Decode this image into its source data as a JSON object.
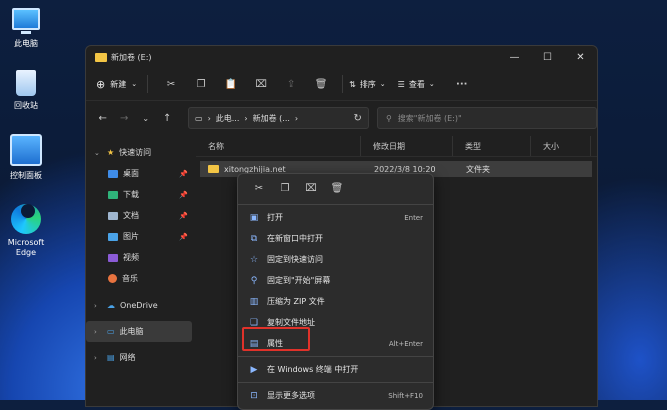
{
  "desktop": {
    "icons": [
      {
        "label": "此电脑",
        "icon": "computer-icon"
      },
      {
        "label": "回收站",
        "icon": "recycle-bin-icon"
      },
      {
        "label": "控制面板",
        "icon": "control-panel-icon"
      },
      {
        "label": "Microsoft Edge",
        "icon": "edge-icon"
      }
    ]
  },
  "window": {
    "title": "新加卷 (E:)",
    "controls": {
      "minimize": "—",
      "maximize": "☐",
      "close": "✕"
    }
  },
  "toolbar": {
    "new_label": "新建",
    "sort_label": "排序",
    "view_label": "查看",
    "more_label": "···"
  },
  "address": {
    "crumb1": "此电...",
    "crumb2": "新加卷 (...",
    "search_placeholder": "搜索\"新加卷 (E:)\""
  },
  "sidebar": {
    "quick_access": "快速访问",
    "items": [
      {
        "label": "桌面",
        "color": "#3f8ce8"
      },
      {
        "label": "下载",
        "color": "#2fb37a"
      },
      {
        "label": "文档",
        "color": "#9fb6cf"
      },
      {
        "label": "图片",
        "color": "#4aa3e8"
      },
      {
        "label": "视频",
        "color": "#8b5bd6"
      },
      {
        "label": "音乐",
        "color": "#e8733f"
      }
    ],
    "onedrive": "OneDrive",
    "this_pc": "此电脑",
    "network": "网络"
  },
  "columns": {
    "name": "名称",
    "modified": "修改日期",
    "type": "类型",
    "size": "大小"
  },
  "file": {
    "name": "xitongzhijia.net",
    "modified": "2022/3/8 10:20",
    "type": "文件夹"
  },
  "context_menu": {
    "items": [
      {
        "label": "打开",
        "shortcut": "Enter"
      },
      {
        "label": "在新窗口中打开",
        "shortcut": ""
      },
      {
        "label": "固定到快速访问",
        "shortcut": ""
      },
      {
        "label": "固定到\"开始\"屏幕",
        "shortcut": ""
      },
      {
        "label": "压缩为 ZIP 文件",
        "shortcut": ""
      },
      {
        "label": "复制文件地址",
        "shortcut": ""
      },
      {
        "label": "属性",
        "shortcut": "Alt+Enter"
      }
    ],
    "terminal": "在 Windows 终端 中打开",
    "more_options": "显示更多选项",
    "more_shortcut": "Shift+F10"
  },
  "colors": {
    "highlight_border": "#e0322a",
    "folder": "#f3c545"
  }
}
